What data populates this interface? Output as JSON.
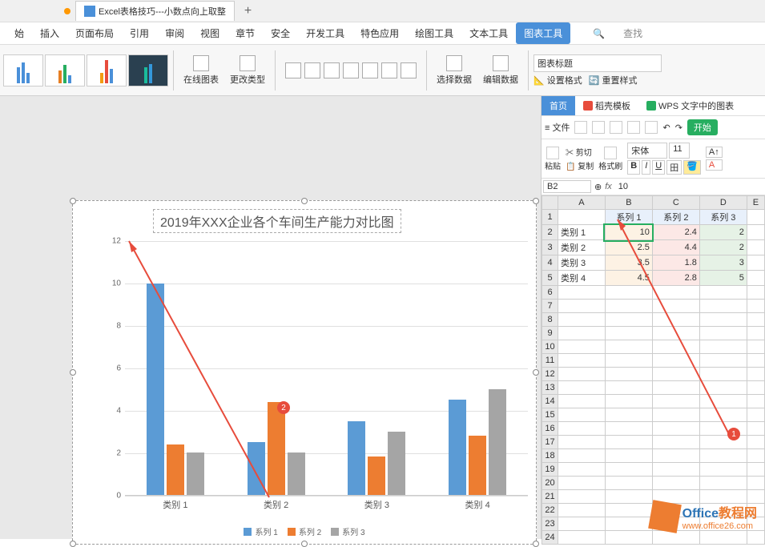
{
  "tab_title": "Excel表格技巧---小数点向上取整",
  "ribbon": {
    "tabs": [
      "始",
      "插入",
      "页面布局",
      "引用",
      "审阅",
      "视图",
      "章节",
      "安全",
      "开发工具",
      "特色应用",
      "绘图工具",
      "文本工具",
      "图表工具"
    ],
    "active": "图表工具",
    "search": "查找"
  },
  "toolbar": {
    "online_chart": "在线图表",
    "change_type": "更改类型",
    "select_data": "选择数据",
    "edit_data": "编辑数据",
    "chart_title_combo": "图表标题",
    "set_format": "设置格式",
    "reset_style": "重置样式"
  },
  "chart": {
    "title": "2019年XXX企业各个车间生产能力对比图",
    "legend": [
      "系列 1",
      "系列 2",
      "系列 3"
    ]
  },
  "chart_data": {
    "type": "bar",
    "title": "2019年XXX企业各个车间生产能力对比图",
    "categories": [
      "类别 1",
      "类别 2",
      "类别 3",
      "类别 4"
    ],
    "series": [
      {
        "name": "系列 1",
        "values": [
          10,
          2.5,
          3.5,
          4.5
        ]
      },
      {
        "name": "系列 2",
        "values": [
          2.4,
          4.4,
          1.8,
          2.8
        ]
      },
      {
        "name": "系列 3",
        "values": [
          2,
          2,
          3,
          5
        ]
      }
    ],
    "ylim": [
      0,
      12
    ],
    "yticks": [
      0,
      2,
      4,
      6,
      8,
      10,
      12
    ],
    "xlabel": "",
    "ylabel": ""
  },
  "annotations": {
    "badge1": "1",
    "badge2": "2"
  },
  "side": {
    "tabs": {
      "home": "首页",
      "template": "稻壳模板",
      "wps": "WPS 文字中的图表"
    },
    "file_menu": "文件",
    "start": "开始",
    "paste": "粘贴",
    "cut": "剪切",
    "copy": "复制",
    "format_painter": "格式刷",
    "font": "宋体",
    "font_size": "11",
    "cell_ref": "B2",
    "formula": "10",
    "cols": [
      "A",
      "B",
      "C",
      "D",
      "E"
    ],
    "rows": [
      "1",
      "2",
      "3",
      "4",
      "5",
      "6",
      "7",
      "8",
      "9",
      "10",
      "11",
      "12",
      "13",
      "14",
      "15",
      "16",
      "17",
      "18",
      "19",
      "20",
      "21",
      "22",
      "23",
      "24"
    ],
    "headers": [
      "",
      "系列 1",
      "系列 2",
      "系列 3"
    ],
    "data": [
      [
        "类别 1",
        "10",
        "2.4",
        "2"
      ],
      [
        "类别 2",
        "2.5",
        "4.4",
        "2"
      ],
      [
        "类别 3",
        "3.5",
        "1.8",
        "3"
      ],
      [
        "类别 4",
        "4.5",
        "2.8",
        "5"
      ]
    ]
  },
  "watermark": {
    "brand_a": "Office",
    "brand_b": "教程网",
    "url": "www.office26.com"
  }
}
